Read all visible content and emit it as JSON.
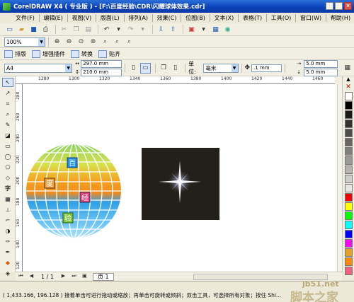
{
  "title": "CorelDRAW X4 ( 专业版 ) - [F:\\百度经验\\CDR\\闪耀球体效果.cdr]",
  "window_buttons": [
    "_",
    "□",
    "×"
  ],
  "menu": [
    "文件(F)",
    "编辑(E)",
    "视图(V)",
    "版面(L)",
    "排列(A)",
    "效果(C)",
    "位图(B)",
    "文本(X)",
    "表格(T)",
    "工具(O)",
    "窗口(W)",
    "帮助(H)"
  ],
  "zoom": {
    "value": "100%"
  },
  "plugins": {
    "items": [
      "排版",
      "增强插件",
      "转换",
      "贴齐"
    ]
  },
  "property_bar": {
    "page_size": "A4",
    "width": "297.0 mm",
    "height": "210.0 mm",
    "units_label": "单位:",
    "units_value": "毫米",
    "nudge": ".1 mm",
    "dup_x": "5.0 mm",
    "dup_y": "5.0 mm"
  },
  "ruler": {
    "h_ticks": [
      "1280",
      "1300",
      "1320",
      "1340",
      "1360",
      "1380",
      "1400",
      "1420",
      "1440",
      "1460",
      "1480"
    ],
    "v_ticks": [
      "280",
      "260",
      "240",
      "220",
      "200",
      "180",
      "160",
      "140",
      "120"
    ]
  },
  "canvas": {
    "sphere_chars": [
      "百",
      "度",
      "经",
      "验"
    ],
    "sparkle_box_color": "#231f1a"
  },
  "palette": {
    "colors": [
      "#ffffff",
      "#000000",
      "#1a1a1a",
      "#333333",
      "#4d4d4d",
      "#666666",
      "#808080",
      "#999999",
      "#b3b3b3",
      "#cccccc",
      "#e6e6e6",
      "#ff0000",
      "#ffff00",
      "#00ff00",
      "#00ffff",
      "#0000ff",
      "#ff00ff",
      "#e8a020",
      "#ff8800",
      "#f06080"
    ]
  },
  "pagebar": {
    "page_count": "1 / 1",
    "page_tab": "页 1"
  },
  "status_text": "( 1,433.166, 196.128 ) 接着单击可进行拖动或缩放；再单击可旋转或倾斜；双击工具，可选择所有对象；按住 Shi...",
  "watermark": {
    "url": "jb51.net",
    "name": "脚本之家"
  }
}
